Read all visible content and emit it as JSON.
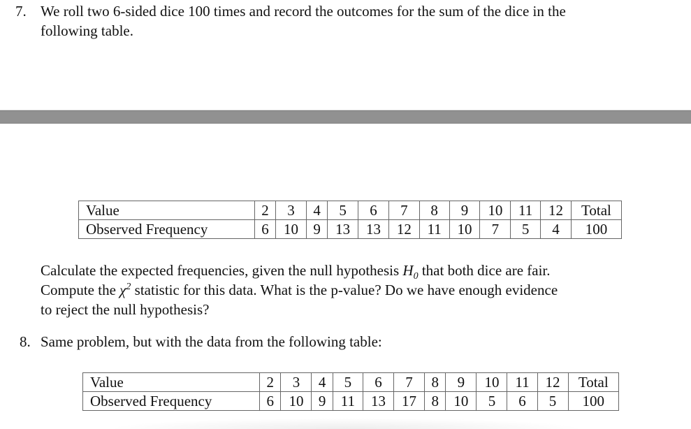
{
  "problem7": {
    "number": "7.",
    "line1": "We roll two 6-sided dice 100 times and record the outcomes for the sum of the dice in the",
    "line2": "following table."
  },
  "table1": {
    "row_labels": [
      "Value",
      "Observed Frequency"
    ],
    "values": [
      "2",
      "3",
      "4",
      "5",
      "6",
      "7",
      "8",
      "9",
      "10",
      "11",
      "12",
      "Total"
    ],
    "observed": [
      "6",
      "10",
      "9",
      "13",
      "13",
      "12",
      "11",
      "10",
      "7",
      "5",
      "4",
      "100"
    ]
  },
  "instructions": {
    "line1_pre": "Calculate the expected frequencies, given the null hypothesis ",
    "h_symbol": "H",
    "h_sub": "0",
    "line1_post": " that both dice are fair.",
    "line2_pre": "Compute the ",
    "chi_symbol": "χ",
    "chi_sup": "2",
    "line2_post": " statistic for this data. What is the p-value? Do we have enough evidence",
    "line3": "to reject the null hypothesis?"
  },
  "problem8": {
    "number": "8.",
    "line1": "Same problem, but with the data from the following table:"
  },
  "table2": {
    "row_labels": [
      "Value",
      "Observed Frequency"
    ],
    "values": [
      "2",
      "3",
      "4",
      "5",
      "6",
      "7",
      "8",
      "9",
      "10",
      "11",
      "12",
      "Total"
    ],
    "observed": [
      "6",
      "10",
      "9",
      "11",
      "13",
      "17",
      "8",
      "10",
      "5",
      "6",
      "5",
      "100"
    ]
  }
}
